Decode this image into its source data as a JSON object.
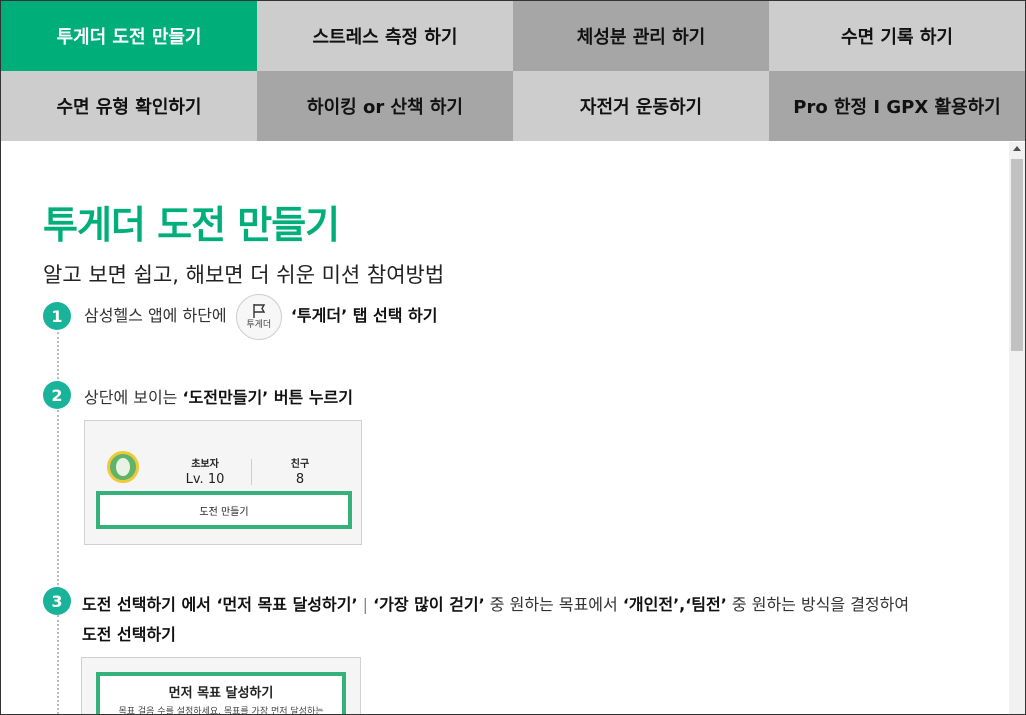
{
  "tabs": [
    {
      "label": "투게더 도전 만들기",
      "style": "active"
    },
    {
      "label": "스트레스 측정 하기",
      "style": "light"
    },
    {
      "label": "체성분 관리 하기",
      "style": "dark"
    },
    {
      "label": "수면 기록 하기",
      "style": "light"
    },
    {
      "label": "수면 유형 확인하기",
      "style": "light"
    },
    {
      "label": "하이킹 or 산책 하기",
      "style": "dark"
    },
    {
      "label": "자전거 운동하기",
      "style": "light"
    },
    {
      "label": "Pro 한정 I GPX 활용하기",
      "style": "dark"
    }
  ],
  "page": {
    "title": "투게더 도전 만들기",
    "subtitle": "알고 보면 쉽고, 해보면 더 쉬운 미션 참여방법"
  },
  "steps": {
    "s1": {
      "num": "1",
      "pre": "삼성헬스 앱에 하단에",
      "icon_label": "투게더",
      "bold": "‘투게더’ 탭 선택 하기"
    },
    "s2": {
      "num": "2",
      "pre": "상단에 보이는",
      "bold": "‘도전만들기’ 버튼 누르기"
    },
    "s3": {
      "num": "3",
      "line1_a": "도전 선택하기 에서 ‘먼저 목표 달성하기’",
      "line1_sep": " | ",
      "line1_b": "‘가장 많이 걷기’",
      "line1_c": " 중 원하는 목표에서 ",
      "line1_d": "‘개인전’,‘팀전’",
      "line1_e": " 중 원하는 방식을 결정하여",
      "line2": "도전 선택하기"
    }
  },
  "card1": {
    "level_label": "초보자",
    "level_value": "Lv. 10",
    "friend_label": "친구",
    "friend_value": "8",
    "button_label": "도전 만들기"
  },
  "card2": {
    "title": "먼저 목표 달성하기",
    "desc": "목표 걸음 수를 설정하세요. 목표를 가장 먼저 달성하는"
  },
  "colors": {
    "accent": "#00ae7a",
    "badge": "#19b39a",
    "tab_light": "#cdcdcd",
    "tab_dark": "#a6a6a6"
  }
}
